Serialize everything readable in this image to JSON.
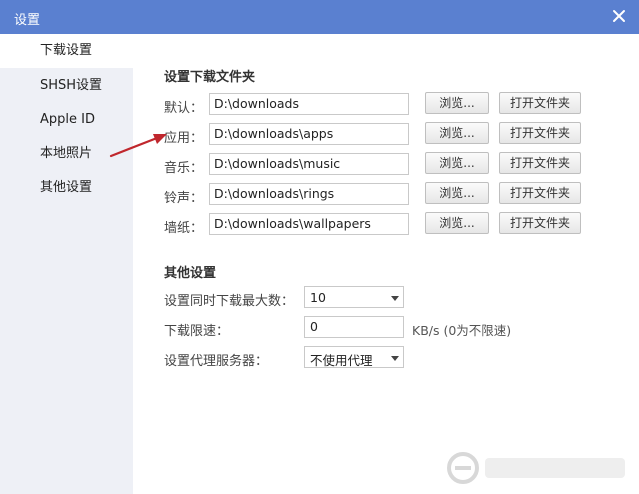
{
  "window": {
    "title": "设置"
  },
  "sidebar": {
    "items": [
      {
        "label": "下载设置"
      },
      {
        "label": "SHSH设置"
      },
      {
        "label": "Apple ID"
      },
      {
        "label": "本地照片"
      },
      {
        "label": "其他设置"
      }
    ]
  },
  "download": {
    "section_title": "设置下载文件夹",
    "rows": [
      {
        "label": "默认：",
        "path": "D:\\downloads",
        "browse": "浏览...",
        "open": "打开文件夹"
      },
      {
        "label": "应用：",
        "path": "D:\\downloads\\apps",
        "browse": "浏览...",
        "open": "打开文件夹"
      },
      {
        "label": "音乐：",
        "path": "D:\\downloads\\music",
        "browse": "浏览...",
        "open": "打开文件夹"
      },
      {
        "label": "铃声：",
        "path": "D:\\downloads\\rings",
        "browse": "浏览...",
        "open": "打开文件夹"
      },
      {
        "label": "墙纸：",
        "path": "D:\\downloads\\wallpapers",
        "browse": "浏览...",
        "open": "打开文件夹"
      }
    ]
  },
  "other": {
    "section_title": "其他设置",
    "max_downloads_label": "设置同时下载最大数：",
    "max_downloads_value": "10",
    "speed_limit_label": "下载限速：",
    "speed_limit_value": "0",
    "speed_limit_unit": "KB/s (0为不限速)",
    "proxy_label": "设置代理服务器：",
    "proxy_value": "不使用代理"
  },
  "icons": {
    "close": "close-icon",
    "annotation": "arrow-icon",
    "watermark": "logo-icon"
  },
  "colors": {
    "titlebar": "#5a80d0",
    "sidebar": "#eef0f6",
    "annotation_arrow": "#c0272d"
  }
}
